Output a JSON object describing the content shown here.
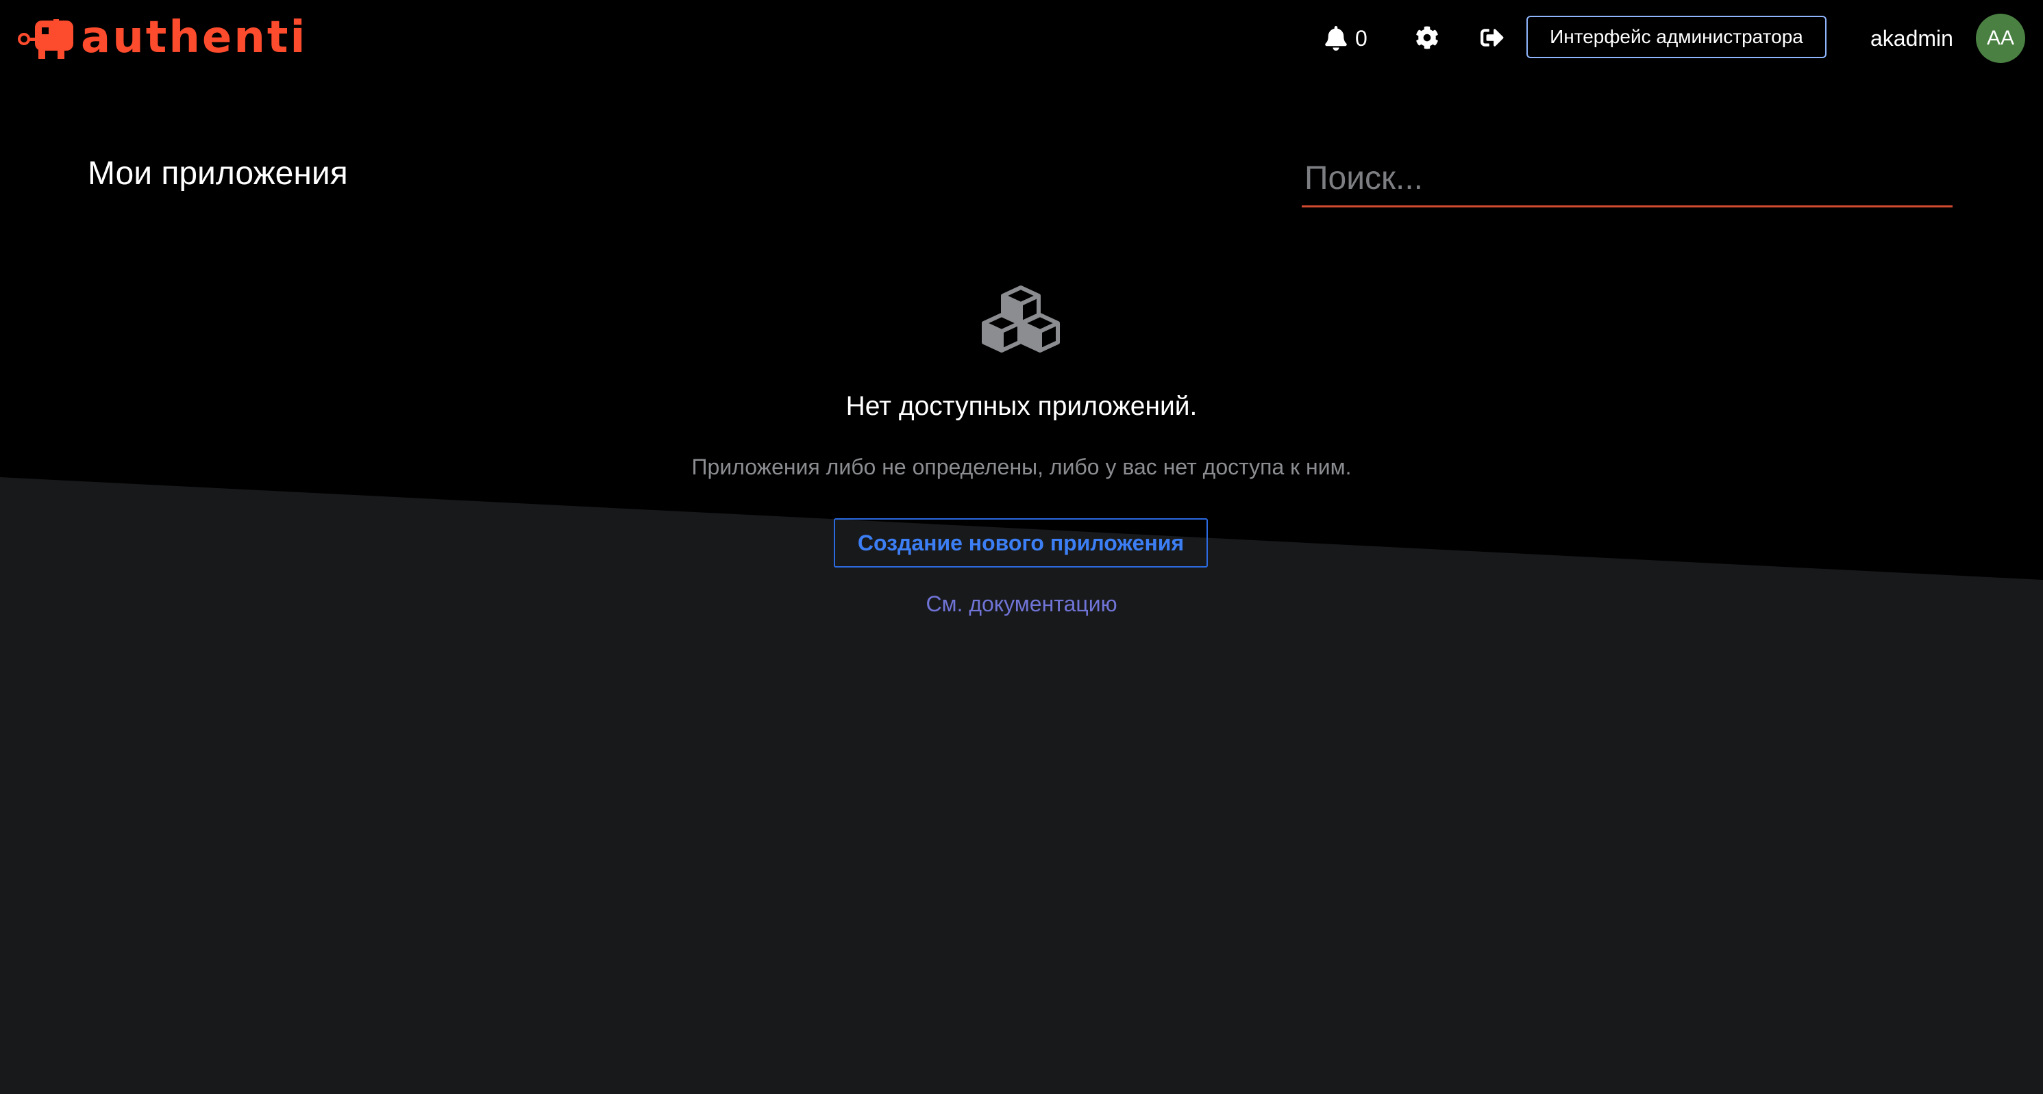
{
  "header": {
    "brand": "authentik",
    "notifications_count": "0",
    "admin_button_label": "Интерфейс администратора",
    "username": "akadmin",
    "avatar_initials": "AA",
    "icons": {
      "notifications": "bell-icon",
      "settings": "gear-icon",
      "logout": "sign-out-icon"
    }
  },
  "main": {
    "title": "Мои приложения",
    "search": {
      "placeholder": "Поиск...",
      "value": ""
    },
    "empty_state": {
      "icon": "cubes-icon",
      "title": "Нет доступных приложений.",
      "body": "Приложения либо не определены, либо у вас нет доступа к ним.",
      "create_button_label": "Создание нового приложения",
      "docs_link_label": "См. документацию"
    }
  },
  "colors": {
    "brand": "#fd4b2d",
    "accent_blue": "#2b6ae0",
    "link": "#7074d6",
    "avatar_bg": "#4a8142",
    "background_top": "#000000",
    "background_bottom": "#18191b"
  }
}
